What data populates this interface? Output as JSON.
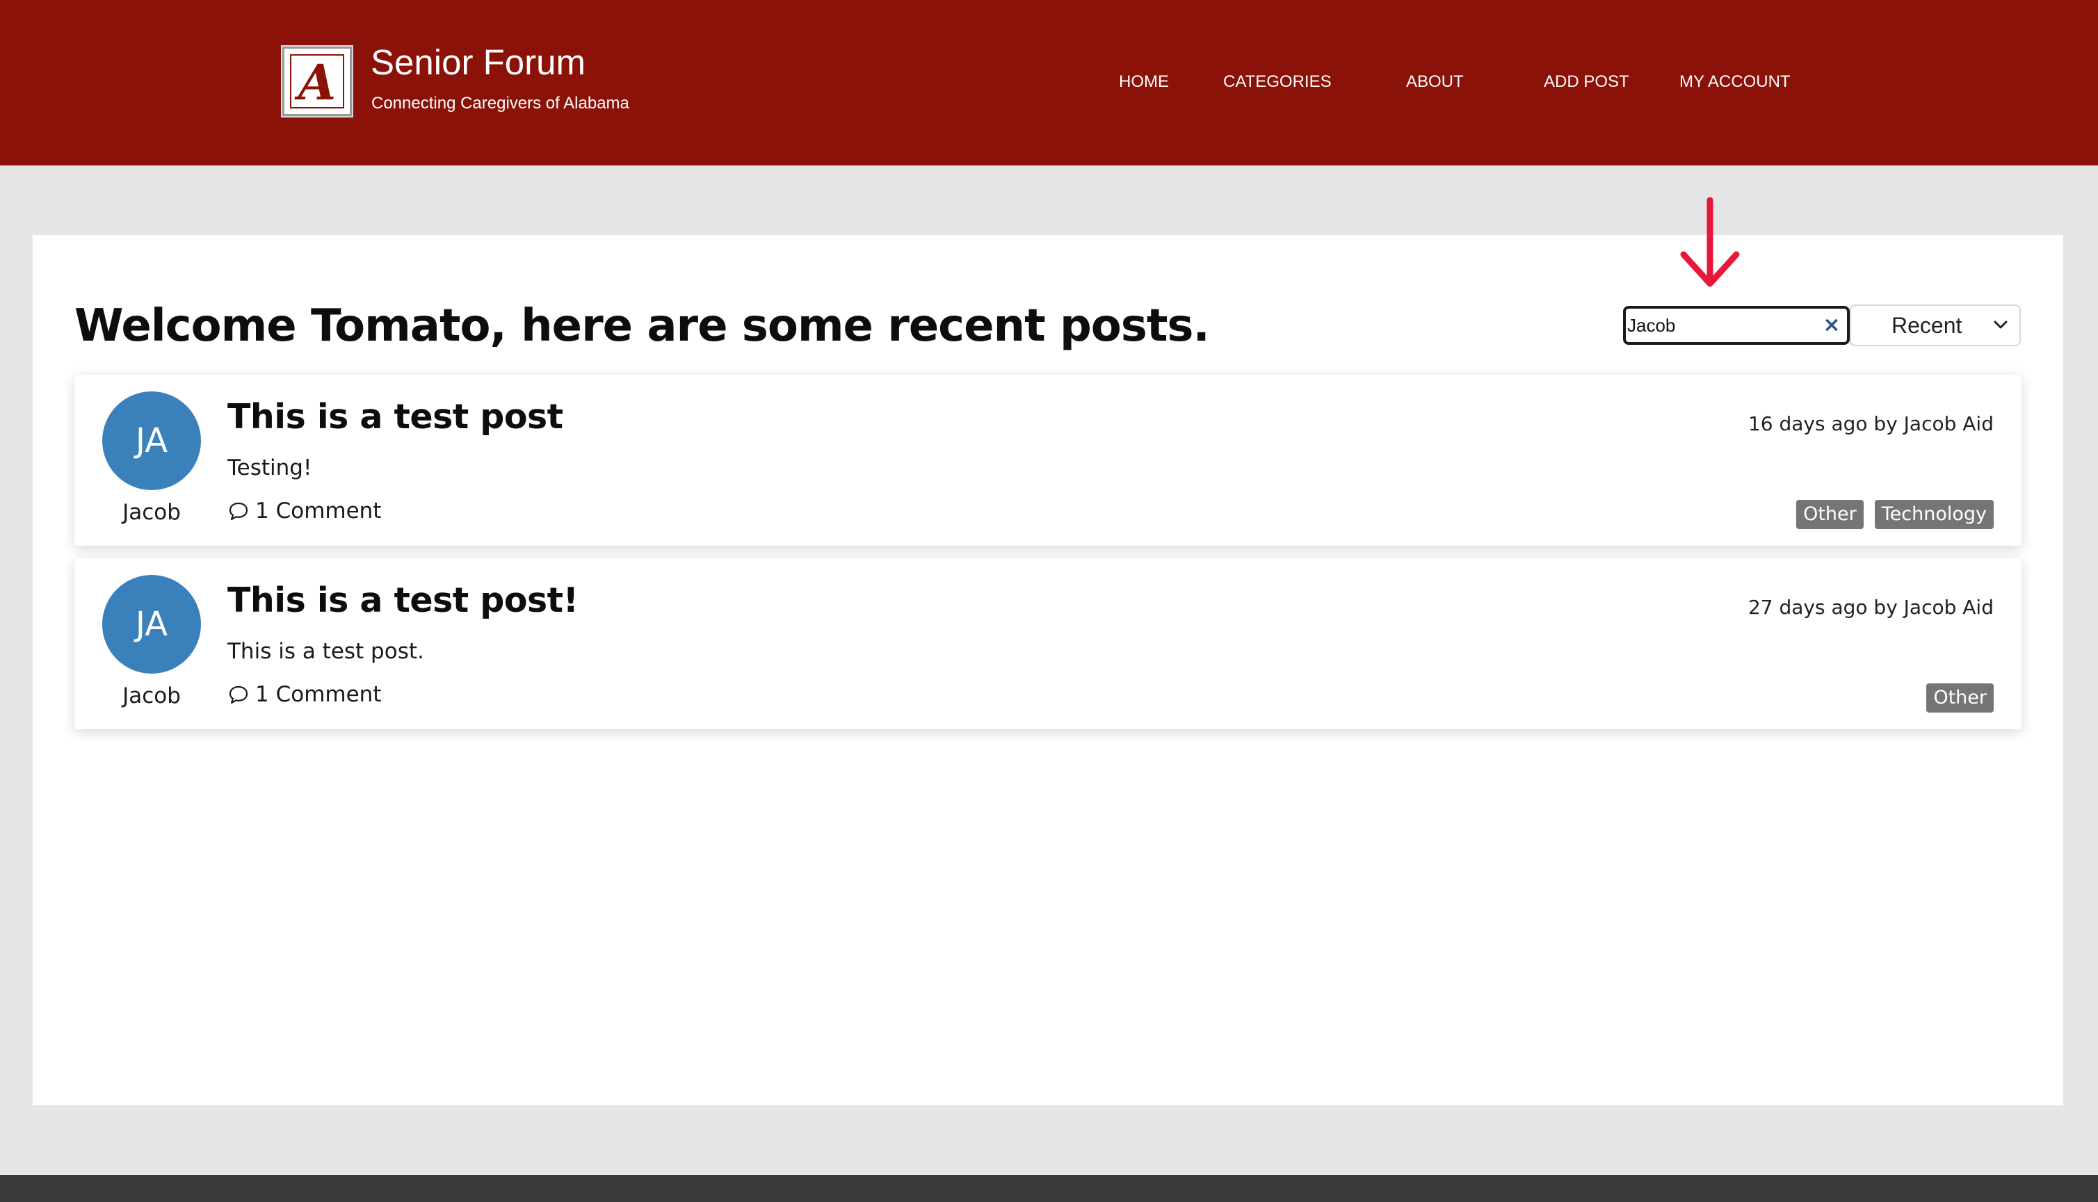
{
  "site": {
    "title": "Senior Forum",
    "subtitle": "Connecting Caregivers of Alabama",
    "logo_letter": "A"
  },
  "nav": {
    "items": [
      {
        "label": "HOME"
      },
      {
        "label": "CATEGORIES"
      },
      {
        "label": "ABOUT"
      },
      {
        "label": "ADD POST"
      },
      {
        "label": "MY ACCOUNT"
      }
    ]
  },
  "page": {
    "heading": "Welcome Tomato, here are some recent posts."
  },
  "search": {
    "value": "Jacob",
    "clear_icon": "×"
  },
  "sort": {
    "selected": "Recent"
  },
  "posts": [
    {
      "initials": "JA",
      "author_short": "Jacob",
      "title": "This is a test post",
      "body": "Testing!",
      "comments": "1 Comment",
      "meta": "16 days ago by Jacob Aid",
      "tags": [
        "Other",
        "Technology"
      ]
    },
    {
      "initials": "JA",
      "author_short": "Jacob",
      "title": "This is a test post!",
      "body": "This is a test post.",
      "comments": "1 Comment",
      "meta": "27 days ago by Jacob Aid",
      "tags": [
        "Other"
      ]
    }
  ],
  "colors": {
    "header_bg": "#8a1208",
    "avatar": "#3a80bb",
    "tag_bg": "#757575",
    "annotation_arrow": "#e8173a",
    "clear_icon": "#2a4f8f"
  },
  "icons": {
    "logo": "alabama-script-a-logo",
    "clear": "close-icon",
    "dropdown": "chevron-down-icon",
    "comment": "speech-bubble-icon",
    "annotation": "red-down-arrow-icon"
  }
}
